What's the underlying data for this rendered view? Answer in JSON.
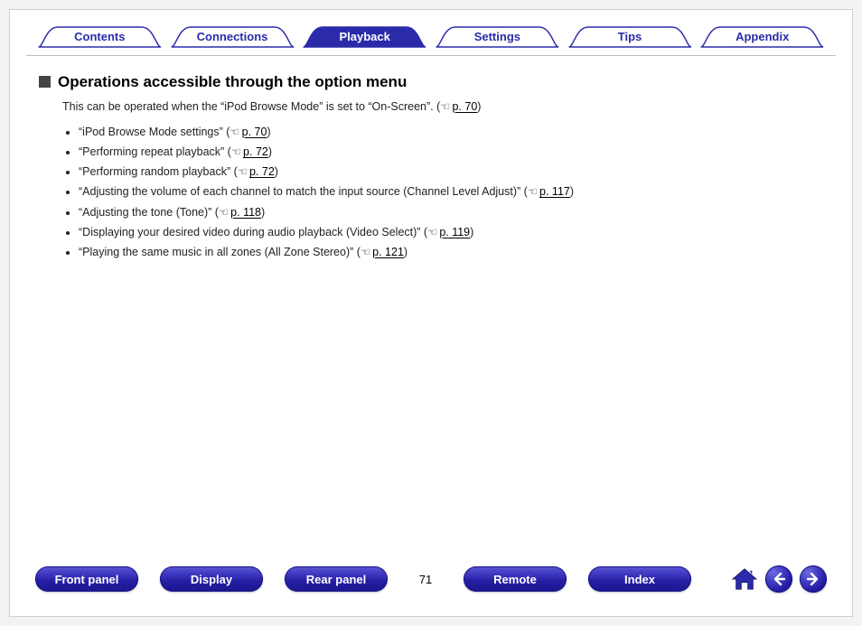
{
  "tabs": [
    {
      "label": "Contents",
      "active": false
    },
    {
      "label": "Connections",
      "active": false
    },
    {
      "label": "Playback",
      "active": true
    },
    {
      "label": "Settings",
      "active": false
    },
    {
      "label": "Tips",
      "active": false
    },
    {
      "label": "Appendix",
      "active": false
    }
  ],
  "heading": "Operations accessible through the option menu",
  "intro": {
    "text_before": "This can be operated when the “iPod Browse Mode” is set to “On-Screen”.  (",
    "link": "p. 70",
    "text_after": ")"
  },
  "bullets": [
    {
      "pre": "“iPod Browse Mode settings” (",
      "link": "p. 70",
      "post": ")"
    },
    {
      "pre": "“Performing repeat playback” (",
      "link": "p. 72",
      "post": ")"
    },
    {
      "pre": "“Performing random playback” (",
      "link": "p. 72",
      "post": ")"
    },
    {
      "pre": "“Adjusting the volume of each channel to match the input source (Channel Level Adjust)” (",
      "link": "p. 117",
      "post": ")"
    },
    {
      "pre": "“Adjusting the tone (Tone)” (",
      "link": "p. 118",
      "post": ")"
    },
    {
      "pre": "“Displaying your desired video during audio playback (Video Select)” (",
      "link": "p. 119",
      "post": ")"
    },
    {
      "pre": "“Playing the same music in all zones (All Zone Stereo)” (",
      "link": "p. 121",
      "post": ")"
    }
  ],
  "page_number": "71",
  "bottom_buttons": [
    {
      "key": "front_panel",
      "label": "Front panel"
    },
    {
      "key": "display",
      "label": "Display"
    },
    {
      "key": "rear_panel",
      "label": "Rear panel"
    },
    {
      "key": "remote",
      "label": "Remote"
    },
    {
      "key": "index",
      "label": "Index"
    }
  ],
  "colors": {
    "brand_blue": "#2b2baa"
  }
}
